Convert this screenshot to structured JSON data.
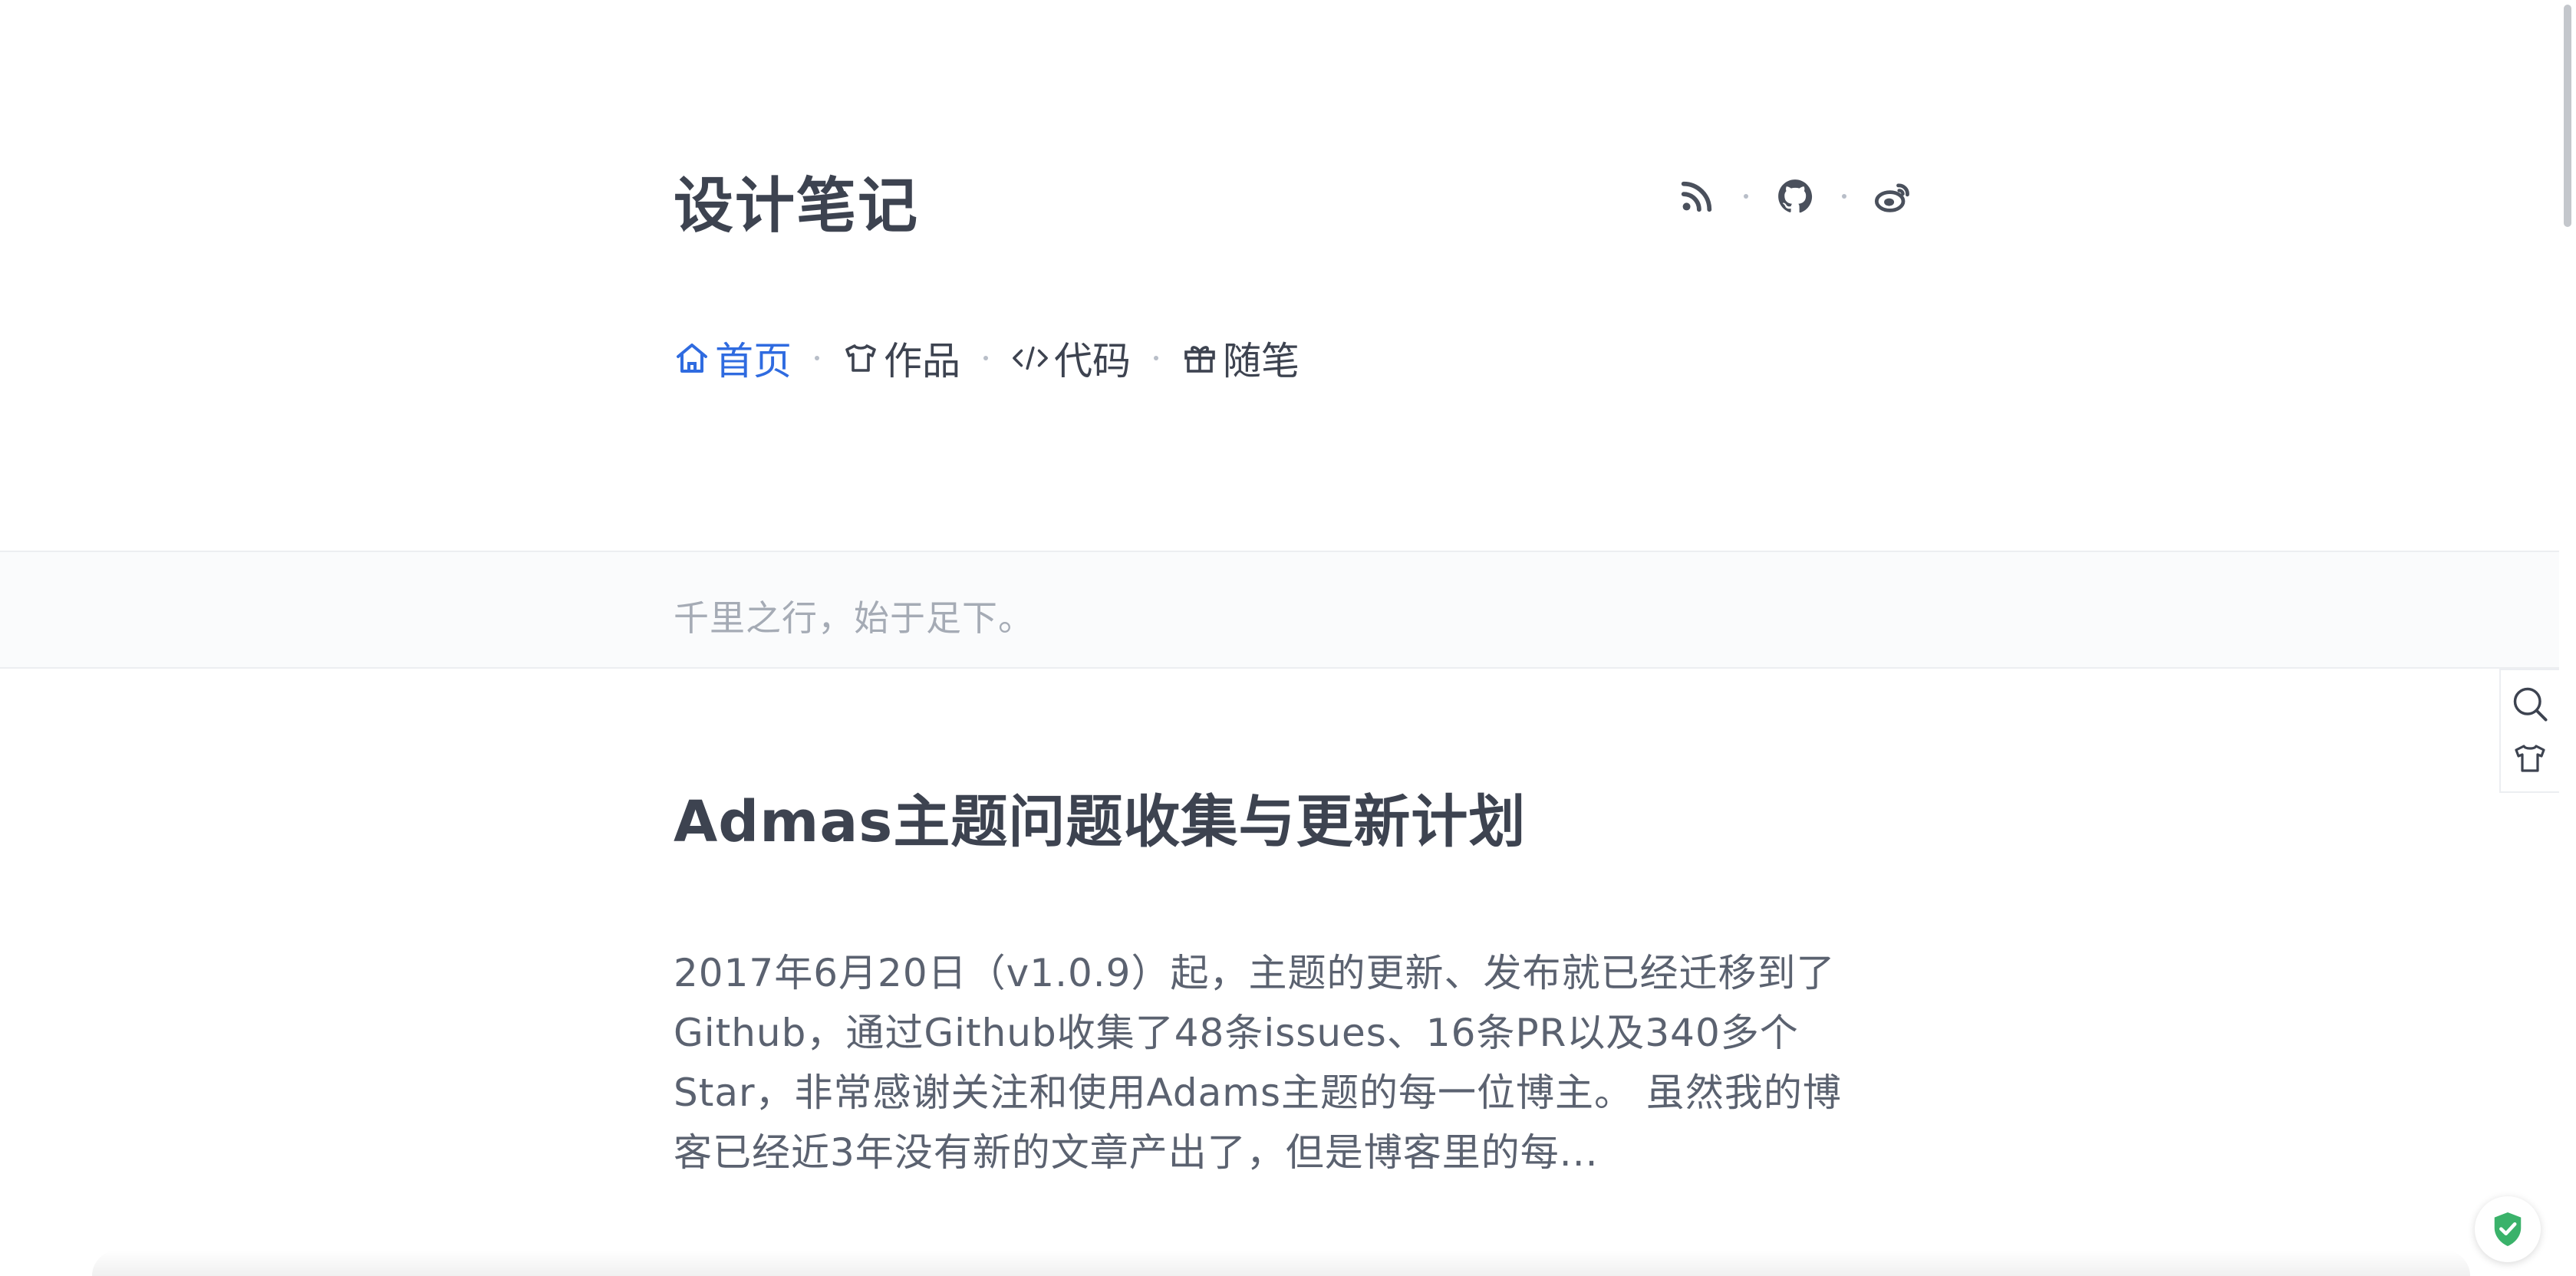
{
  "header": {
    "site_title": "设计笔记",
    "social": [
      {
        "name": "rss-icon"
      },
      {
        "name": "github-icon"
      },
      {
        "name": "weibo-icon"
      }
    ]
  },
  "nav": {
    "items": [
      {
        "label": "首页",
        "icon": "home-icon",
        "active": true
      },
      {
        "label": "作品",
        "icon": "shirt-icon",
        "active": false
      },
      {
        "label": "代码",
        "icon": "code-icon",
        "active": false
      },
      {
        "label": "随笔",
        "icon": "gift-icon",
        "active": false
      }
    ]
  },
  "motto": "千里之行，始于足下。",
  "post": {
    "title": "Admas主题问题收集与更新计划",
    "excerpt": "2017年6月20日（v1.0.9）起，主题的更新、发布就已经迁移到了Github，通过Github收集了48条issues、16条PR以及340多个Star，非常感谢关注和使用Adams主题的每一位博主。 虽然我的博客已经近3年没有新的文章产出了，但是博客里的每..."
  },
  "colors": {
    "accent": "#2f6be0",
    "text": "#3d4350",
    "muted": "#a5abb5",
    "shield": "#3ab26a"
  }
}
